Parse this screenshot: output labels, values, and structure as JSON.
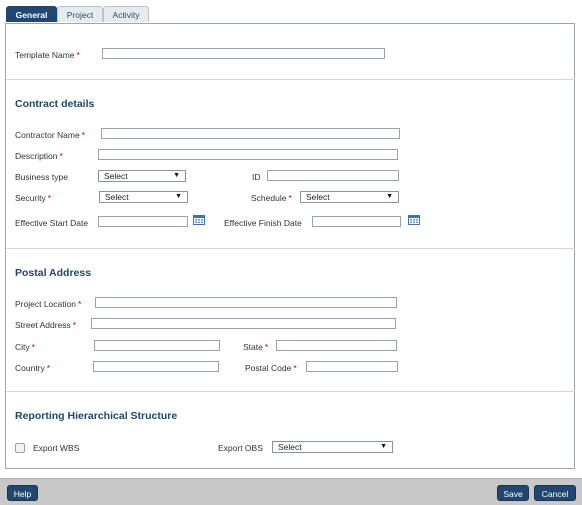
{
  "tabs": [
    "General",
    "Project",
    "Activity"
  ],
  "template": {
    "name_label": "Template Name"
  },
  "contract": {
    "title": "Contract details",
    "contractor_name_label": "Contractor Name",
    "description_label": "Description",
    "business_type_label": "Business type",
    "business_type_value": "Select",
    "id_label": "ID",
    "security_label": "Security",
    "security_value": "Select",
    "schedule_label": "Schedule",
    "schedule_value": "Select",
    "start_date_label": "Effective Start Date",
    "finish_date_label": "Effective Finish Date"
  },
  "postal": {
    "title": "Postal Address",
    "project_location_label": "Project Location",
    "street_address_label": "Street Address",
    "city_label": "City",
    "state_label": "State",
    "country_label": "Country",
    "postal_code_label": "Postal Code"
  },
  "reporting": {
    "title": "Reporting Hierarchical Structure",
    "export_wbs_label": "Export WBS",
    "export_obs_label": "Export OBS",
    "export_obs_value": "Select"
  },
  "footer": {
    "help": "Help",
    "save": "Save",
    "cancel": "Cancel"
  },
  "required_marker": "*",
  "dropdown_arrow": "▼",
  "icons": {
    "calendar": "calendar-icon",
    "checkbox": "checkbox-icon",
    "dropdown": "chevron-down-icon"
  },
  "colors": {
    "accent": "#21466f",
    "required": "#cc0000",
    "footer_bg": "#c8c8c8"
  }
}
